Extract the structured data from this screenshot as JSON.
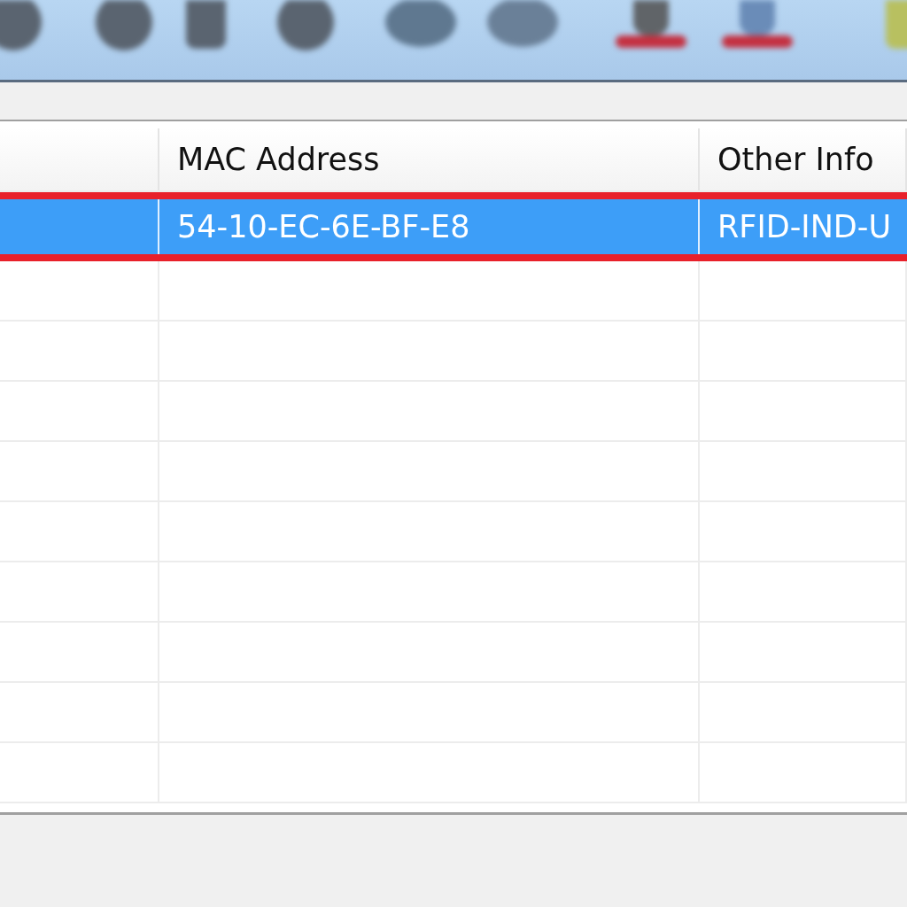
{
  "table": {
    "columns": [
      {
        "label": "MAC Address"
      },
      {
        "label": "Other Info"
      }
    ],
    "rows": [
      {
        "selected": true,
        "mac_address": "54-10-EC-6E-BF-E8",
        "other_info": "RFID-IND-U"
      }
    ]
  }
}
